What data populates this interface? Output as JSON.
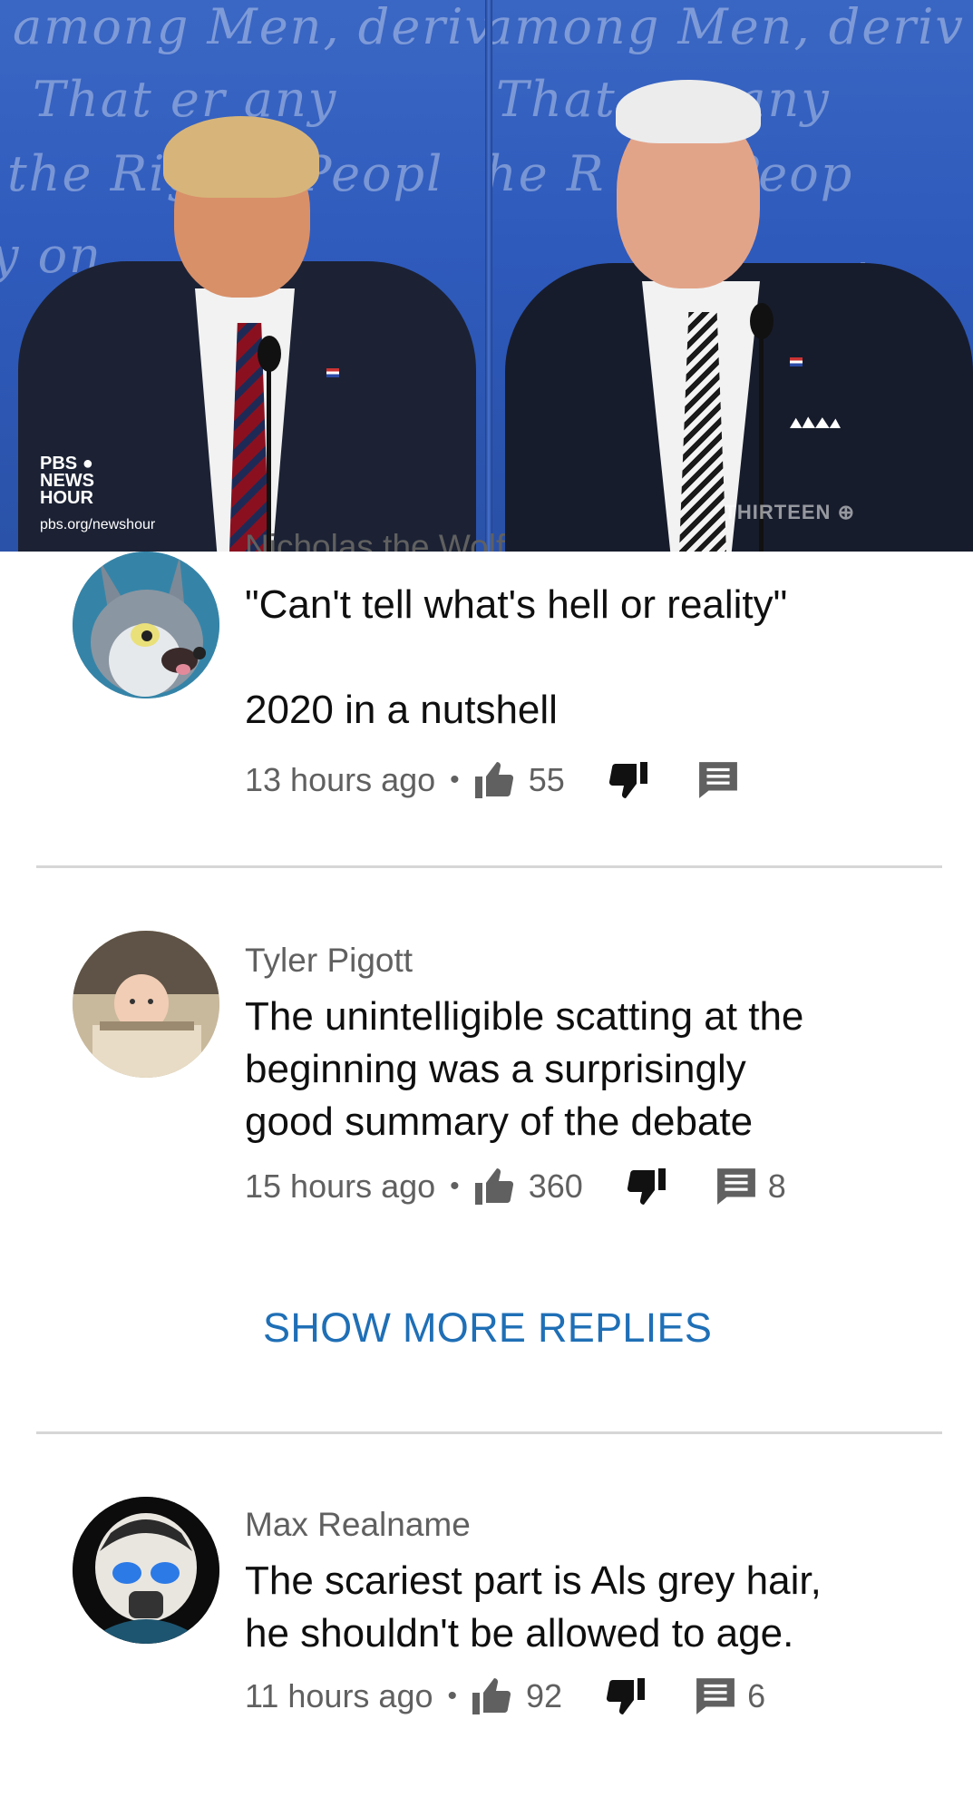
{
  "video": {
    "overlay_left_title": "PBS",
    "overlay_left_lines": [
      "NEWS",
      "HOUR"
    ],
    "overlay_left_url": "pbs.org/newshour",
    "overlay_right": "THIRTEEN",
    "background_color": "#2f5bbd"
  },
  "comments": [
    {
      "author": "Nicholas the Wolf",
      "text_lines": [
        "\"Can't tell what's hell or reality\"",
        "",
        "2020 in a nutshell"
      ],
      "time": "13 hours ago",
      "likes": "55",
      "replies": "",
      "avatar_icon": "wolf-avatar-icon"
    },
    {
      "author": "Tyler Pigott",
      "text_lines": [
        "The unintelligible scatting at the",
        "beginning was a surprisingly",
        "good summary of the debate"
      ],
      "time": "15 hours ago",
      "likes": "360",
      "replies": "8",
      "avatar_icon": "baby-photo-avatar-icon"
    },
    {
      "author": "Max Realname",
      "text_lines": [
        "The scariest part is Als grey hair,",
        "he shouldn't be allowed to age."
      ],
      "time": "11 hours ago",
      "likes": "92",
      "replies": "6",
      "avatar_icon": "masked-character-avatar-icon"
    }
  ],
  "show_more_label": "SHOW MORE REPLIES",
  "colors": {
    "link_blue": "#1f6fb6",
    "meta_gray": "#606060",
    "divider": "#d6d6d6"
  },
  "icons": {
    "like": "thumbs-up-icon",
    "dislike": "thumbs-down-icon",
    "reply": "comment-icon"
  }
}
